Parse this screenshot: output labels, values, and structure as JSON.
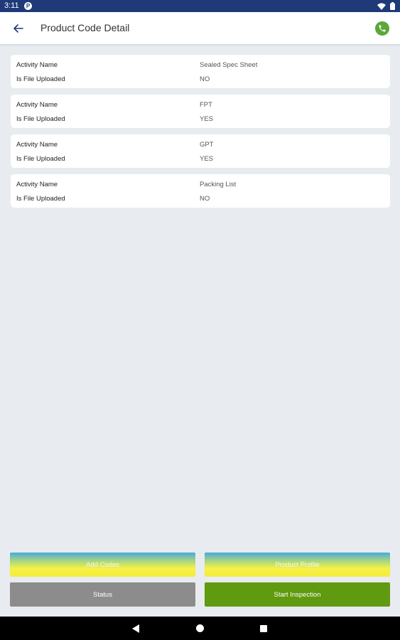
{
  "status_bar": {
    "time": "3:11",
    "notification_letter": "P"
  },
  "app_bar": {
    "title": "Product Code Detail"
  },
  "activities": [
    {
      "activity_label": "Activity Name",
      "activity_value": "Sealed Spec Sheet",
      "uploaded_label": "Is File Uploaded",
      "uploaded_value": "NO"
    },
    {
      "activity_label": "Activity Name",
      "activity_value": "FPT",
      "uploaded_label": "Is File Uploaded",
      "uploaded_value": "YES"
    },
    {
      "activity_label": "Activity Name",
      "activity_value": "GPT",
      "uploaded_label": "Is File Uploaded",
      "uploaded_value": "YES"
    },
    {
      "activity_label": "Activity Name",
      "activity_value": "Packing List",
      "uploaded_label": "Is File Uploaded",
      "uploaded_value": "NO"
    }
  ],
  "buttons": {
    "add_codes": "Add Codes",
    "product_profile": "Product Profile",
    "status": "Status",
    "start_inspection": "Start Inspection"
  },
  "colors": {
    "status_bar": "#1e3a78",
    "call_icon": "#5aa83a",
    "status_button": "#8c8c8c",
    "start_button": "#609a10"
  },
  "icons": [
    "back-arrow-icon",
    "phone-icon",
    "wifi-icon",
    "battery-icon",
    "nav-back-icon",
    "nav-home-icon",
    "nav-recents-icon"
  ]
}
